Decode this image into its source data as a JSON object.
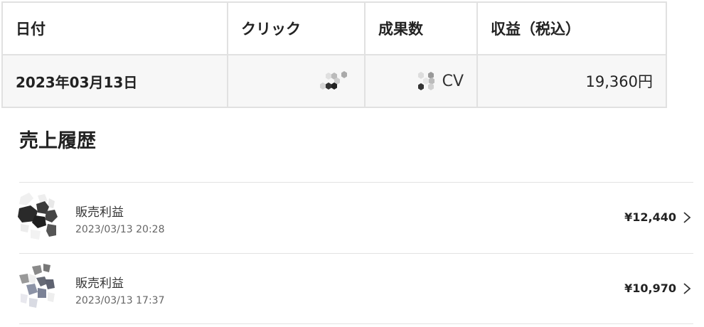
{
  "stats_table": {
    "headers": {
      "date": "日付",
      "click": "クリック",
      "conversions": "成果数",
      "revenue": "収益（税込）"
    },
    "row": {
      "date": "2023年03月13日",
      "cv_unit": "CV",
      "revenue": "19,360円"
    }
  },
  "history": {
    "title": "売上履歴",
    "items": [
      {
        "title": "販売利益",
        "time": "2023/03/13 20:28",
        "amount": "¥12,440"
      },
      {
        "title": "販売利益",
        "time": "2023/03/13 17:37",
        "amount": "¥10,970"
      }
    ]
  },
  "colors": {
    "border": "#e1e1e1",
    "row_bg": "#f7f7f7",
    "text": "#222222",
    "muted": "#666666"
  },
  "icons": {
    "click_count": "redacted-hex-icon",
    "cv_count": "redacted-hex-icon",
    "avatar": "avatar-icon",
    "chevron": "chevron-right-icon"
  }
}
